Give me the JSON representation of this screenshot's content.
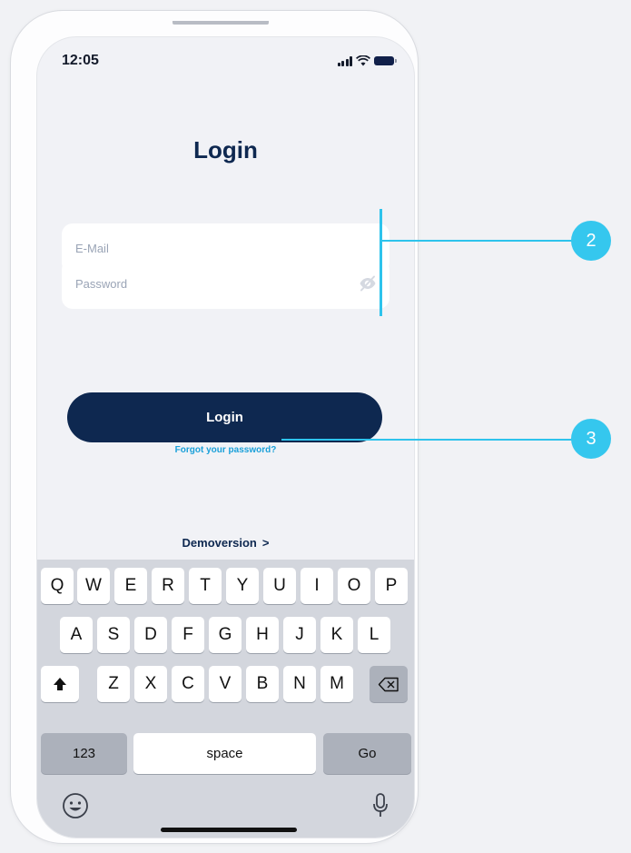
{
  "status_bar": {
    "time": "12:05"
  },
  "login": {
    "title": "Login",
    "email_placeholder": "E-Mail",
    "password_placeholder": "Password",
    "login_button": "Login",
    "forgot_password": "Forgot your password?",
    "demo_version": "Demoversion",
    "demo_chevron": ">"
  },
  "keyboard": {
    "row1": [
      "Q",
      "W",
      "E",
      "R",
      "T",
      "Y",
      "U",
      "I",
      "O",
      "P"
    ],
    "row2": [
      "A",
      "S",
      "D",
      "F",
      "G",
      "H",
      "J",
      "K",
      "L"
    ],
    "row3": [
      "Z",
      "X",
      "C",
      "V",
      "B",
      "N",
      "M"
    ],
    "numbers": "123",
    "space": "space",
    "go": "Go"
  },
  "annotations": {
    "badge_2": "2",
    "badge_3": "3"
  },
  "colors": {
    "primary": "#0e2850",
    "link": "#1aa0d9",
    "annotation": "#35c7ee",
    "background": "#f1f2f5"
  }
}
